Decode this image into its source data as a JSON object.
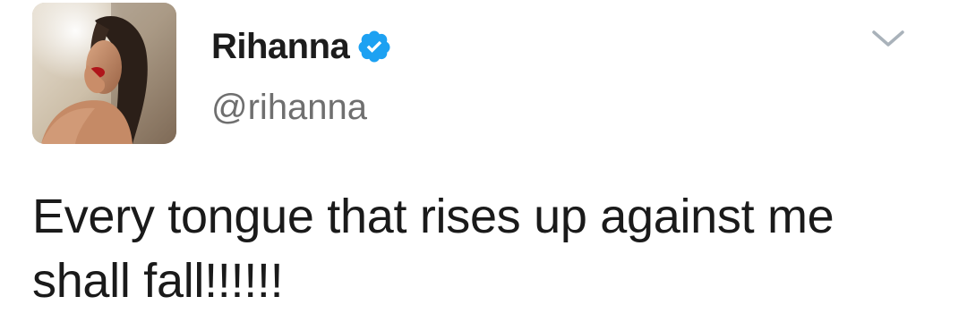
{
  "user": {
    "display_name": "Rihanna",
    "handle": "@rihanna",
    "verified": true,
    "verified_icon": "verified-badge-icon",
    "avatar_icon": "profile-photo"
  },
  "menu": {
    "icon": "chevron-down-icon"
  },
  "tweet": {
    "line1": "Every tongue that rises up against me",
    "line2": "shall fall!!!!!!"
  },
  "colors": {
    "verified_blue": "#1da1f2",
    "name_text": "#1c1c1c",
    "handle_text": "#6f6f6f",
    "body_text": "#1a1a1a",
    "caret": "#a9b2ba"
  }
}
